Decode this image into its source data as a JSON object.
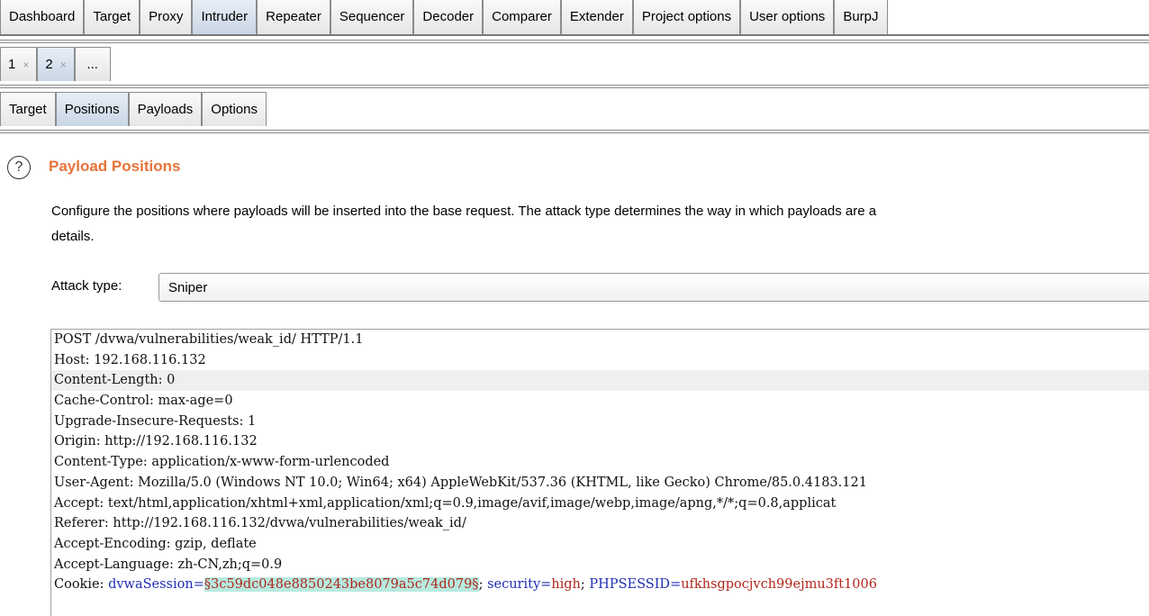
{
  "main_tabs": [
    {
      "label": "Dashboard",
      "active": false
    },
    {
      "label": "Target",
      "active": false
    },
    {
      "label": "Proxy",
      "active": false
    },
    {
      "label": "Intruder",
      "active": true
    },
    {
      "label": "Repeater",
      "active": false
    },
    {
      "label": "Sequencer",
      "active": false
    },
    {
      "label": "Decoder",
      "active": false
    },
    {
      "label": "Comparer",
      "active": false
    },
    {
      "label": "Extender",
      "active": false
    },
    {
      "label": "Project options",
      "active": false
    },
    {
      "label": "User options",
      "active": false
    },
    {
      "label": "BurpJ",
      "active": false
    }
  ],
  "attack_tabs": [
    {
      "label": "1",
      "close": "×",
      "active": false
    },
    {
      "label": "2",
      "close": "×",
      "active": true
    },
    {
      "label": "...",
      "close": "",
      "active": false
    }
  ],
  "intruder_tabs": [
    {
      "label": "Target",
      "active": false
    },
    {
      "label": "Positions",
      "active": true
    },
    {
      "label": "Payloads",
      "active": false
    },
    {
      "label": "Options",
      "active": false
    }
  ],
  "positions": {
    "help_glyph": "?",
    "title": "Payload Positions",
    "description_line1": "Configure the positions where payloads will be inserted into the base request. The attack type determines the way in which payloads are a",
    "description_line2": "details.",
    "attack_type_label": "Attack type:",
    "attack_type_value": "Sniper"
  },
  "request": {
    "lines": [
      "POST /dvwa/vulnerabilities/weak_id/ HTTP/1.1",
      "Host: 192.168.116.132",
      "Content-Length: 0",
      "Cache-Control: max-age=0",
      "Upgrade-Insecure-Requests: 1",
      "Origin: http://192.168.116.132",
      "Content-Type: application/x-www-form-urlencoded",
      "User-Agent: Mozilla/5.0 (Windows NT 10.0; Win64; x64) AppleWebKit/537.36 (KHTML, like Gecko) Chrome/85.0.4183.121",
      "Accept: text/html,application/xhtml+xml,application/xml;q=0.9,image/avif,image/webp,image/apng,*/*;q=0.8,applicat",
      "Referer: http://192.168.116.132/dvwa/vulnerabilities/weak_id/",
      "Accept-Encoding: gzip, deflate",
      "Accept-Language: zh-CN,zh;q=0.9"
    ],
    "highlighted_line_index": 2,
    "cookie": {
      "prefix": "Cookie: ",
      "name1": "dvwaSession",
      "eq1": "=",
      "payload": "§3c59dc048e8850243be8079a5c74d079§",
      "sep1": "; ",
      "name2": "security",
      "eq2": "=",
      "val2": "high",
      "sep2": "; ",
      "name3": "PHPSESSID",
      "eq3": "=",
      "val3": "ufkhsgpocjvch99ejmu3ft1006"
    }
  }
}
